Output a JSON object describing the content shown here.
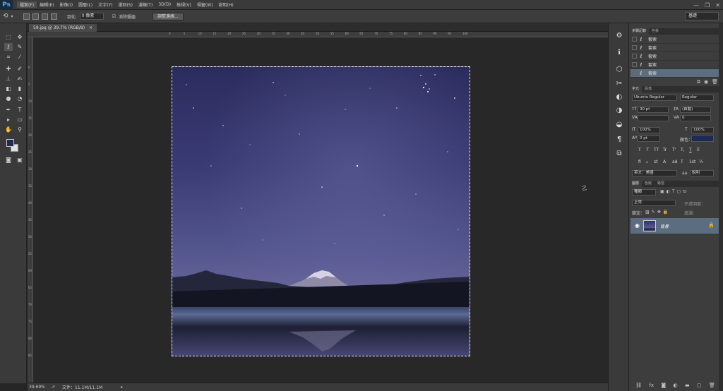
{
  "menubar": {
    "logo": "Ps",
    "items": [
      "檔案(F)",
      "編輯(E)",
      "影像(I)",
      "圖層(L)",
      "文字(Y)",
      "選取(S)",
      "濾鏡(T)",
      "3D(D)",
      "檢視(V)",
      "視窗(W)",
      "說明(H)"
    ],
    "window_controls": [
      "—",
      "❐",
      "✕"
    ]
  },
  "options_bar": {
    "feather_label": "羽化:",
    "feather_value": "0 像素",
    "antialias_label": "消除鋸齒",
    "refine_button": "調整邊緣...",
    "workspace": "基礎"
  },
  "document": {
    "tab_title": "59.jpg @ 39.7% (RGB/8)",
    "ruler_ticks": [
      "0",
      "5",
      "10",
      "15",
      "20",
      "25",
      "30",
      "35",
      "40",
      "45",
      "50",
      "55",
      "60",
      "65",
      "70",
      "75",
      "80",
      "85",
      "90",
      "95",
      "100"
    ],
    "vertical_ticks": [
      "0",
      "5",
      "10",
      "15",
      "20",
      "25",
      "30",
      "35",
      "40",
      "45",
      "50",
      "55",
      "60",
      "65",
      "70",
      "75",
      "80",
      "85"
    ]
  },
  "status": {
    "zoom": "39.69%",
    "doc_info": "文件：11.1M/11.1M"
  },
  "history_panel": {
    "tabs": [
      "步驟記錄",
      "色板"
    ],
    "items": [
      "套索",
      "套索",
      "套索",
      "套索",
      "套索"
    ],
    "selected_index": 4
  },
  "character_panel": {
    "tabs": [
      "字元",
      "段落"
    ],
    "font_family": "Ubuntu Regular",
    "font_style": "Regular",
    "font_size": "30 pt",
    "leading": "(自動)",
    "kerning": "",
    "tracking": "0",
    "vertical_scale": "100%",
    "horizontal_scale": "100%",
    "baseline_shift": "0 pt",
    "color_label": "顏色：",
    "color_swatch": "#1f2a55",
    "glyph_buttons": [
      "T",
      "T",
      "TT",
      "Tr",
      "T'",
      "T,",
      "T",
      "T̶"
    ],
    "opentype_buttons": [
      "fi",
      "ℴ",
      "st",
      "A",
      "ad",
      "T",
      "1st",
      "½"
    ],
    "language": "英文：美國",
    "antialias": "銳利"
  },
  "layers_panel": {
    "tabs": [
      "圖層",
      "色版",
      "路徑"
    ],
    "filter": "種類",
    "blend_mode": "正常",
    "opacity_label": "不透明度：",
    "lock_label": "鎖定：",
    "fill_label": "填滿：",
    "layer_name": "背景"
  },
  "colors": {
    "foreground": "#1f2a55",
    "background": "#e0e0e0",
    "selection_highlight": "#5c6d80"
  }
}
